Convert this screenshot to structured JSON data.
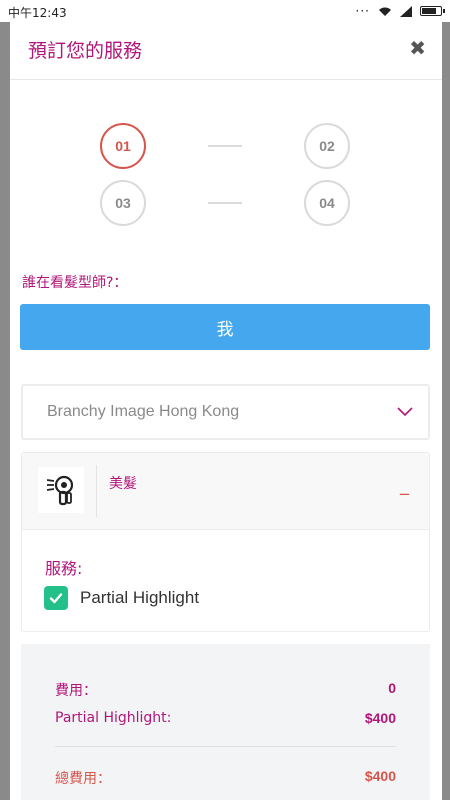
{
  "status_bar": {
    "time": "中午12:43",
    "battery_level": 0.85
  },
  "header": {
    "title": "預訂您的服務",
    "close_glyph": "✖"
  },
  "steps": [
    "01",
    "02",
    "03",
    "04"
  ],
  "active_step": "01",
  "who": {
    "label": "誰在看髮型師?：",
    "button_label": "我"
  },
  "salon_select": {
    "value": "Branchy Image Hong Kong"
  },
  "category": {
    "name": "美髮",
    "toggle": "_",
    "icon": "hair-dryer-icon"
  },
  "services": {
    "label": "服務:",
    "items": [
      {
        "name": "Partial Highlight",
        "checked": true
      }
    ]
  },
  "summary": {
    "fee_label": "費用：",
    "fee_value": "0",
    "item_label": "Partial Highlight:",
    "item_value": "$400",
    "total_label": "總費用：",
    "total_value": "$400"
  },
  "colors": {
    "brand": "#b0167a",
    "primary_button": "#45a8ee",
    "active_step": "#d6564c",
    "checkbox": "#23c08a"
  }
}
